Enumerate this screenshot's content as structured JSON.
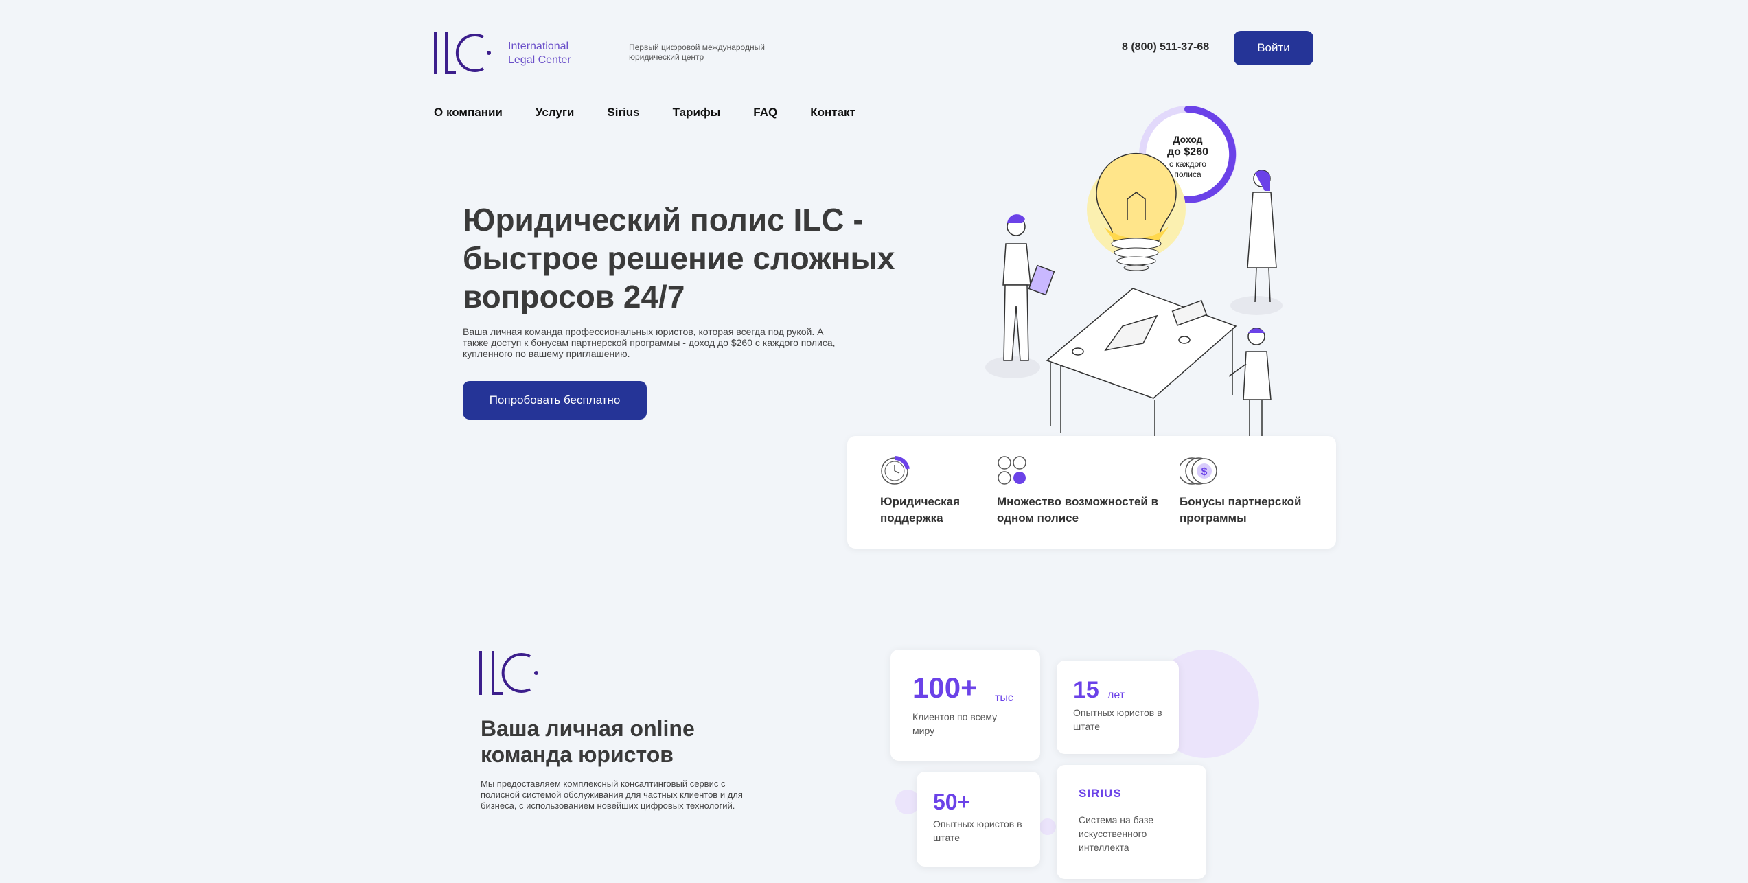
{
  "header": {
    "logo_text_line1": "International",
    "logo_text_line2": "Legal Center",
    "tagline": "Первый цифровой международный юридический центр",
    "phone": "8 (800) 511-37-68",
    "login_label": "Войти"
  },
  "nav": {
    "items": [
      {
        "label": "О компании"
      },
      {
        "label": "Услуги"
      },
      {
        "label": "Sirius"
      },
      {
        "label": "Тарифы"
      },
      {
        "label": "FAQ"
      },
      {
        "label": "Контакт"
      }
    ]
  },
  "hero": {
    "title": "Юридический полис ILC - быстрое решение сложных вопросов 24/7",
    "subtitle": "Ваша личная команда профессиональных юристов, которая всегда под рукой. А также доступ к бонусам партнерской программы - доход до $260 с каждого полиса, купленного по вашему приглашению.",
    "cta_label": "Попробовать бесплатно",
    "badge": {
      "line1": "Доход",
      "line2": "до $260",
      "line3": "с каждого",
      "line4": "полиса"
    }
  },
  "features": [
    {
      "label": "Юридическая поддержка",
      "icon": "clock-icon"
    },
    {
      "label": "Множество возможностей в одном полисе",
      "icon": "grid-icon"
    },
    {
      "label": "Бонусы партнерской программы",
      "icon": "dollar-coin-icon"
    }
  ],
  "about": {
    "title": "Ваша личная online команда юристов",
    "text": "Мы предоставляем комплексный консалтинговый сервис с полисной системой обслуживания для частных клиентов и для бизнеса, с использованием новейших цифровых технологий.",
    "stats": [
      {
        "number": "100+",
        "unit": "тыс",
        "desc": "Клиентов по всему миру"
      },
      {
        "number": "15",
        "unit": "лет",
        "desc": "Опытных юристов в штате"
      },
      {
        "number": "50+",
        "unit": "",
        "desc": "Опытных юристов в штате"
      },
      {
        "number": "SIRIUS",
        "unit": "",
        "desc": "Система на базе искусственного интеллекта"
      }
    ]
  },
  "colors": {
    "primary": "#253497",
    "accent": "#6b42e8",
    "background": "#f2f5f9"
  }
}
